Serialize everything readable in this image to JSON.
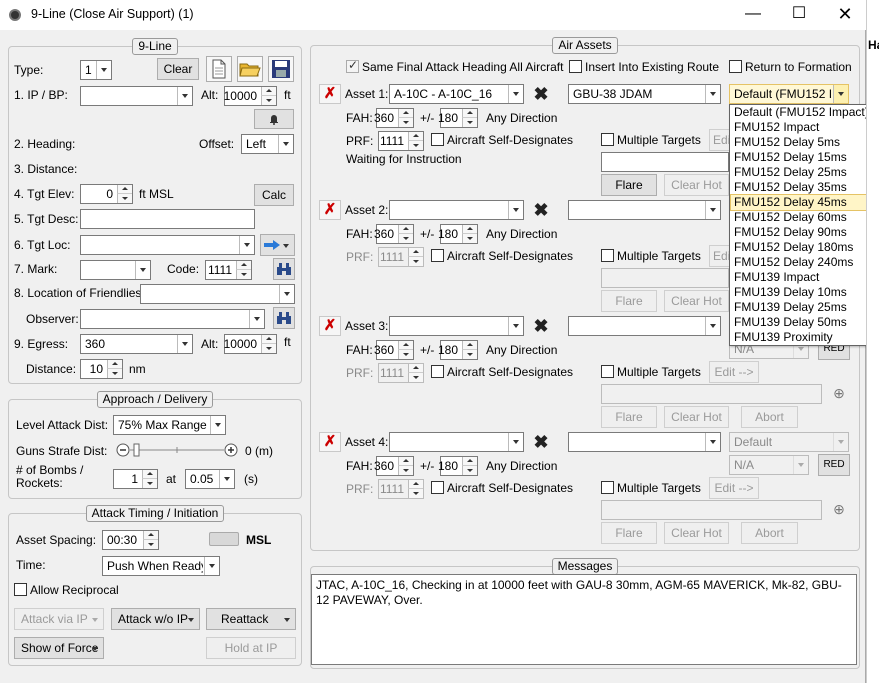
{
  "window": {
    "title": "9-Line (Close Air Support) (1)",
    "right_clip": "Ha"
  },
  "nine_line": {
    "group_title": "9-Line",
    "type_label": "Type:",
    "type_value": "1",
    "clear_button": "Clear",
    "ip_label": "1. IP / BP:",
    "ip_value": "",
    "alt_label": "Alt:",
    "alt_value": "10000",
    "alt_unit": "ft",
    "heading_label": "2. Heading:",
    "offset_label": "Offset:",
    "offset_value": "Left",
    "distance_label": "3. Distance:",
    "tgt_elev_label": "4. Tgt Elev:",
    "tgt_elev_value": "0",
    "tgt_elev_unit": "ft MSL",
    "calc_button": "Calc",
    "tgt_desc_label": "5. Tgt Desc:",
    "tgt_desc_value": "",
    "tgt_loc_label": "6. Tgt Loc:",
    "tgt_loc_value": "",
    "mark_label": "7. Mark:",
    "mark_value": "",
    "code_label": "Code:",
    "code_value": "1111",
    "friendlies_label": "8. Location of Friendlies:",
    "friendlies_value": "",
    "observer_label": "Observer:",
    "observer_value": "",
    "egress_label": "9. Egress:",
    "egress_value": "360",
    "egress_alt_label": "Alt:",
    "egress_alt_value": "10000",
    "egress_alt_unit": "ft",
    "dist_label": "Distance:",
    "dist_value": "10",
    "dist_unit": "nm"
  },
  "approach": {
    "group_title": "Approach / Delivery",
    "level_label": "Level Attack Dist:",
    "level_value": "75% Max Range",
    "guns_label": "Guns Strafe Dist:",
    "guns_value": "0 (m)",
    "bombs_label1": "# of Bombs /",
    "bombs_label2": "Rockets:",
    "bombs_value": "1",
    "at_label": "at",
    "interval_value": "0.05",
    "interval_unit": "(s)"
  },
  "timing": {
    "group_title": "Attack Timing / Initiation",
    "spacing_label": "Asset Spacing:",
    "spacing_value": "00:30",
    "msl_label": "MSL",
    "time_label": "Time:",
    "time_value": "Push When Ready",
    "reciprocal_label": "Allow Reciprocal",
    "attack_ip_button": "Attack via IP",
    "attack_wo_ip_button": "Attack w/o IP",
    "reattack_button": "Reattack",
    "show_force_button": "Show of Force",
    "hold_ip_button": "Hold at IP"
  },
  "air_assets": {
    "group_title": "Air Assets",
    "same_heading_label": "Same Final Attack Heading All Aircraft",
    "insert_route_label": "Insert Into Existing Route",
    "return_formation_label": "Return to Formation",
    "fah_label": "FAH:",
    "pm_label": "+/-",
    "any_dir_label": "Any Direction",
    "prf_label": "PRF:",
    "self_designates_label": "Aircraft Self-Designates",
    "multiple_targets_label": "Multiple Targets",
    "edit_button": "Edit -->",
    "flare_button": "Flare",
    "clear_hot_button": "Clear Hot",
    "abort_button": "Abort",
    "assets": [
      {
        "label": "Asset 1:",
        "aircraft": "A-10C - A-10C_16",
        "weapon": "GBU-38 JDAM",
        "fuze": "Default (FMU152 I",
        "fah": "360",
        "pm": "180",
        "prf": "1111",
        "status": "Waiting for Instruction"
      },
      {
        "label": "Asset 2:",
        "aircraft": "",
        "weapon": "",
        "fah": "360",
        "pm": "180",
        "prf": "1111"
      },
      {
        "label": "Asset 3:",
        "aircraft": "",
        "weapon": "",
        "fah": "360",
        "pm": "180",
        "prf": "1111",
        "fuze_na": "N/A",
        "red_label": "RED"
      },
      {
        "label": "Asset 4:",
        "aircraft": "",
        "weapon": "",
        "fah": "360",
        "pm": "180",
        "prf": "1111",
        "fuze": "Default",
        "fuze_na": "N/A",
        "red_label": "RED"
      }
    ]
  },
  "fuze_dropdown": {
    "selected": "FMU152 Delay 45ms",
    "options": [
      "Default (FMU152 Impact)",
      "FMU152 Impact",
      "FMU152 Delay 5ms",
      "FMU152 Delay 15ms",
      "FMU152 Delay 25ms",
      "FMU152 Delay 35ms",
      "FMU152 Delay 45ms",
      "FMU152 Delay 60ms",
      "FMU152 Delay 90ms",
      "FMU152 Delay 180ms",
      "FMU152 Delay 240ms",
      "FMU139 Impact",
      "FMU139 Delay 10ms",
      "FMU139 Delay 25ms",
      "FMU139 Delay 50ms",
      "FMU139 Proximity"
    ]
  },
  "messages": {
    "group_title": "Messages",
    "text": "JTAC, A-10C_16, Checking in at 10000 feet with GAU-8 30mm, AGM-65 MAVERICK, Mk-82, GBU-12 PAVEWAY, Over."
  }
}
